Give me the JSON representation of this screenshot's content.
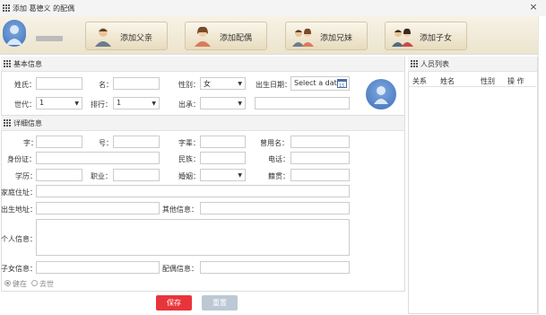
{
  "window": {
    "title": "添加 葛德义 的配偶",
    "close": "×"
  },
  "toolbar": {
    "buttons": [
      {
        "label": "添加父亲"
      },
      {
        "label": "添加配偶"
      },
      {
        "label": "添加兄妹"
      },
      {
        "label": "添加子女"
      }
    ]
  },
  "basic": {
    "header": "基本信息",
    "surname_label": "姓氏：",
    "given_label": "名：",
    "gender_label": "性别：",
    "gender_value": "女",
    "birth_label": "出生日期：",
    "birth_placeholder": "Select a date",
    "generation_label": "世代：",
    "generation_value": "1",
    "rank_label": "排行：",
    "rank_value": "1",
    "lineage_label": "出承："
  },
  "detail": {
    "header": "详细信息",
    "zi_label": "字：",
    "hao_label": "号：",
    "xuehao_label": "字辈：",
    "former_name_label": "曾用名：",
    "id_label": "身份证：",
    "ethnic_label": "民族：",
    "phone_label": "电话：",
    "education_label": "学历：",
    "job_label": "职业：",
    "marriage_label": "婚姻：",
    "native_label": "籍贯：",
    "address_label": "家庭住址：",
    "birthplace_label": "出生地址：",
    "other_label": "其他信息：",
    "personal_label": "个人信息：",
    "children_label": "子女信息：",
    "spouse_label": "配偶信息：",
    "alive_label": "健在",
    "dead_label": "去世"
  },
  "actions": {
    "save": "保存",
    "reset": "重置"
  },
  "people": {
    "header": "人员列表",
    "columns": [
      "关系",
      "姓名",
      "性别",
      "操 作"
    ]
  },
  "colors": {
    "save": "#e8353b",
    "reset": "#bcc8d4"
  }
}
